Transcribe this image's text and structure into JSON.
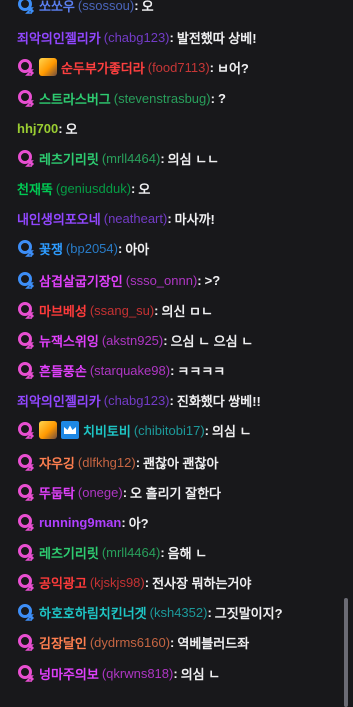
{
  "colors": {
    "background": "#18181b",
    "message_text": "#efeff1",
    "sub_badge_pink": "#e84fd1",
    "sub_badge_blue": "#3d8ef7",
    "crown_badge": "#1e88e5"
  },
  "chat": [
    {
      "user": "쏘쏘우",
      "login": "(ssossou)",
      "message": "오",
      "color": "#5b7ff0",
      "badge": "blue"
    },
    {
      "user": "죄악의인젤리카",
      "login": "(chabg123)",
      "message": "발전했따 상베!",
      "color": "#9147ff",
      "badge": ""
    },
    {
      "user": "순두부가좋더라",
      "login": "(food7113)",
      "message": "ㅂ어?",
      "color": "#ff4040",
      "badge": "pink",
      "badge2": "emote"
    },
    {
      "user": "스트라스버그",
      "login": "(stevenstrasbug)",
      "message": "?",
      "color": "#2ecc71",
      "badge": "pink"
    },
    {
      "user": "hhj700",
      "login": "",
      "message": "오",
      "color": "#9acd32",
      "badge": ""
    },
    {
      "user": "레츠기리릿",
      "login": "(mrll4464)",
      "message": "의심 ㄴㄴ",
      "color": "#2ecc71",
      "badge": "pink"
    },
    {
      "user": "천재뚝",
      "login": "(geniusdduk)",
      "message": "오",
      "color": "#00c853",
      "badge": ""
    },
    {
      "user": "내인생의포오네",
      "login": "(neatheart)",
      "message": "마사까!",
      "color": "#9147ff",
      "badge": ""
    },
    {
      "user": "꽃쟁",
      "login": "(bp2054)",
      "message": "아아",
      "color": "#2e9cff",
      "badge": "blue"
    },
    {
      "user": "삼겹살굽기장인",
      "login": "(ssso_onnn)",
      "message": ">?",
      "color": "#e040fb",
      "badge": "blue"
    },
    {
      "user": "마브베성",
      "login": "(ssang_su)",
      "message": "의신 ㅁㄴ",
      "color": "#ff3b3b",
      "badge": "pink"
    },
    {
      "user": "뉴잭스위잉",
      "login": "(akstn925)",
      "message": "으심 ㄴ 으심 ㄴ",
      "color": "#e040fb",
      "badge": "pink"
    },
    {
      "user": "흔들풍손",
      "login": "(starquake98)",
      "message": "ㅋㅋㅋㅋ",
      "color": "#e040fb",
      "badge": "pink"
    },
    {
      "user": "죄악의인젤리카",
      "login": "(chabg123)",
      "message": "진화했다 쌍베!!",
      "color": "#9147ff",
      "badge": ""
    },
    {
      "user": "치비토비",
      "login": "(chibitobi17)",
      "message": "의심 ㄴ",
      "color": "#1ec5c5",
      "badge": "pink",
      "badge2": "emote",
      "badge3": "crown"
    },
    {
      "user": "쟈우깅",
      "login": "(dlfkhg12)",
      "message": "괜찮아 괜찮아",
      "color": "#ff7f50",
      "badge": "pink"
    },
    {
      "user": "뚜둡탁",
      "login": "(onege)",
      "message": "오 흘리기 잘한다",
      "color": "#e040fb",
      "badge": "pink"
    },
    {
      "user": "running9man",
      "login": "",
      "message": "아?",
      "color": "#b040ff",
      "badge": "pink"
    },
    {
      "user": "레츠기리릿",
      "login": "(mrll4464)",
      "message": "음해 ㄴ",
      "color": "#2ecc71",
      "badge": "pink"
    },
    {
      "user": "공익광고",
      "login": "(kjskjs98)",
      "message": "전사장 뭐하는거야",
      "color": "#ff3b3b",
      "badge": "pink"
    },
    {
      "user": "하호호하림치킨너겟",
      "login": "(ksh4352)",
      "message": "그짓말이지?",
      "color": "#1ec5c5",
      "badge": "blue"
    },
    {
      "user": "김장달인",
      "login": "(dydrms6160)",
      "message": "역베블러드좌",
      "color": "#ff7f50",
      "badge": "pink"
    },
    {
      "user": "넝마주의보",
      "login": "(qkrwns818)",
      "message": "의심 ㄴ",
      "color": "#e040fb",
      "badge": "pink"
    }
  ]
}
